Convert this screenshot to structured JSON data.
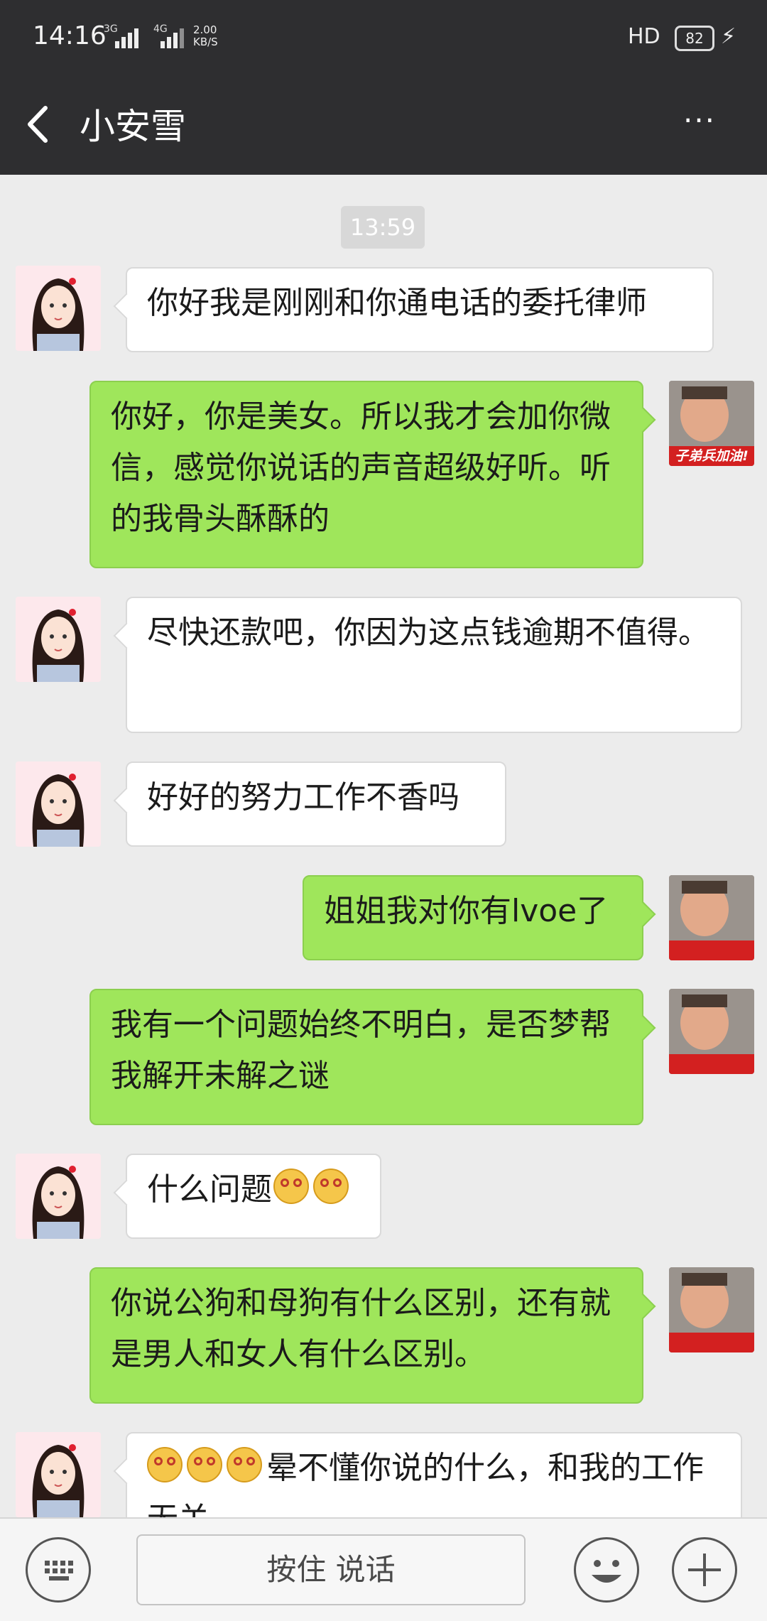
{
  "status_bar": {
    "time": "14:16",
    "network_labels": [
      "3G",
      "4G"
    ],
    "speed_value": "2.00",
    "speed_unit": "KB/S",
    "hd": "HD",
    "battery": "82"
  },
  "header": {
    "title": "小安雪",
    "more": "···"
  },
  "chat": {
    "timestamp": "13:59",
    "messages": [
      {
        "from": "them",
        "text": "你好我是刚刚和你通电话的委托律师"
      },
      {
        "from": "me",
        "text": "你好，你是美女。所以我才会加你微信，感觉你说话的声音超级好听。听的我骨头酥酥的"
      },
      {
        "from": "them",
        "text": "尽快还款吧，你因为这点钱逾期不值得。"
      },
      {
        "from": "them",
        "text": "好好的努力工作不香吗"
      },
      {
        "from": "me",
        "text": "姐姐我对你有lvoe了"
      },
      {
        "from": "me",
        "text": "我有一个问题始终不明白，是否梦帮我解开未解之谜"
      },
      {
        "from": "them",
        "text": "什么问题"
      },
      {
        "from": "me",
        "text": "你说公狗和母狗有什么区别，还有就是男人和女人有什么区别。"
      },
      {
        "from": "them",
        "text": "晕不懂你说的什么，和我的工作无关"
      }
    ],
    "my_avatar_caption": "子弟兵加油!"
  },
  "input_bar": {
    "hold_to_talk": "按住 说话"
  }
}
